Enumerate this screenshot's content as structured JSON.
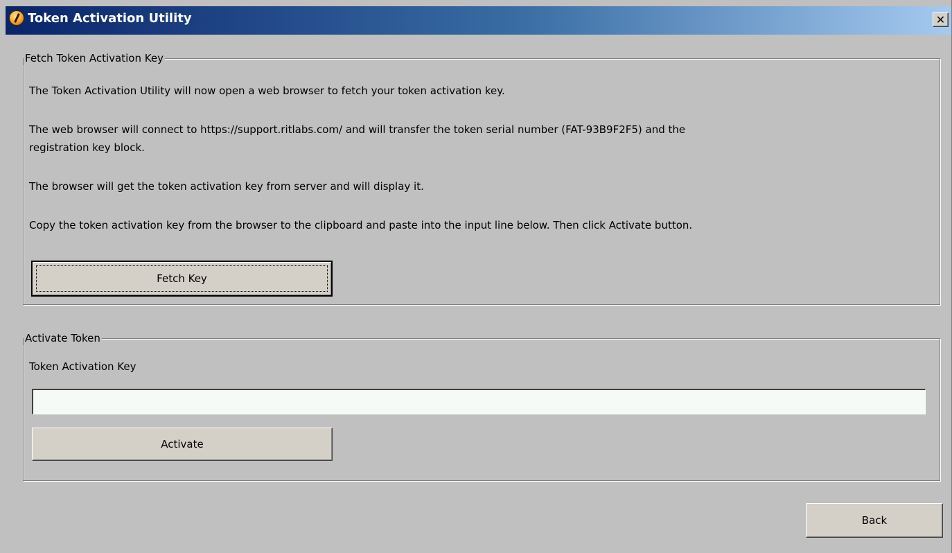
{
  "window": {
    "title": "Token Activation Utility",
    "close_label": "✕"
  },
  "fetch_group": {
    "legend": "Fetch Token Activation Key",
    "para1": "The Token Activation Utility will now open a web browser to fetch your token activation key.",
    "para2_line1": "The web browser will connect to https://support.ritlabs.com/ and will transfer the token serial number (FAT-93B9F2F5) and the",
    "para2_line2": "registration key block.",
    "para3": "The browser will get the token activation key from server and will display it.",
    "para4": "Copy the token activation key from the browser to the clipboard and paste into the input line below. Then click Activate button.",
    "fetch_button": "Fetch Key"
  },
  "activate_group": {
    "legend": "Activate Token",
    "key_label": "Token Activation Key",
    "key_value": "",
    "activate_button": "Activate"
  },
  "footer": {
    "back_button": "Back"
  },
  "colors": {
    "titlebar_start": "#0a246a",
    "titlebar_end": "#a6caf0",
    "face": "#c0c0c0"
  }
}
